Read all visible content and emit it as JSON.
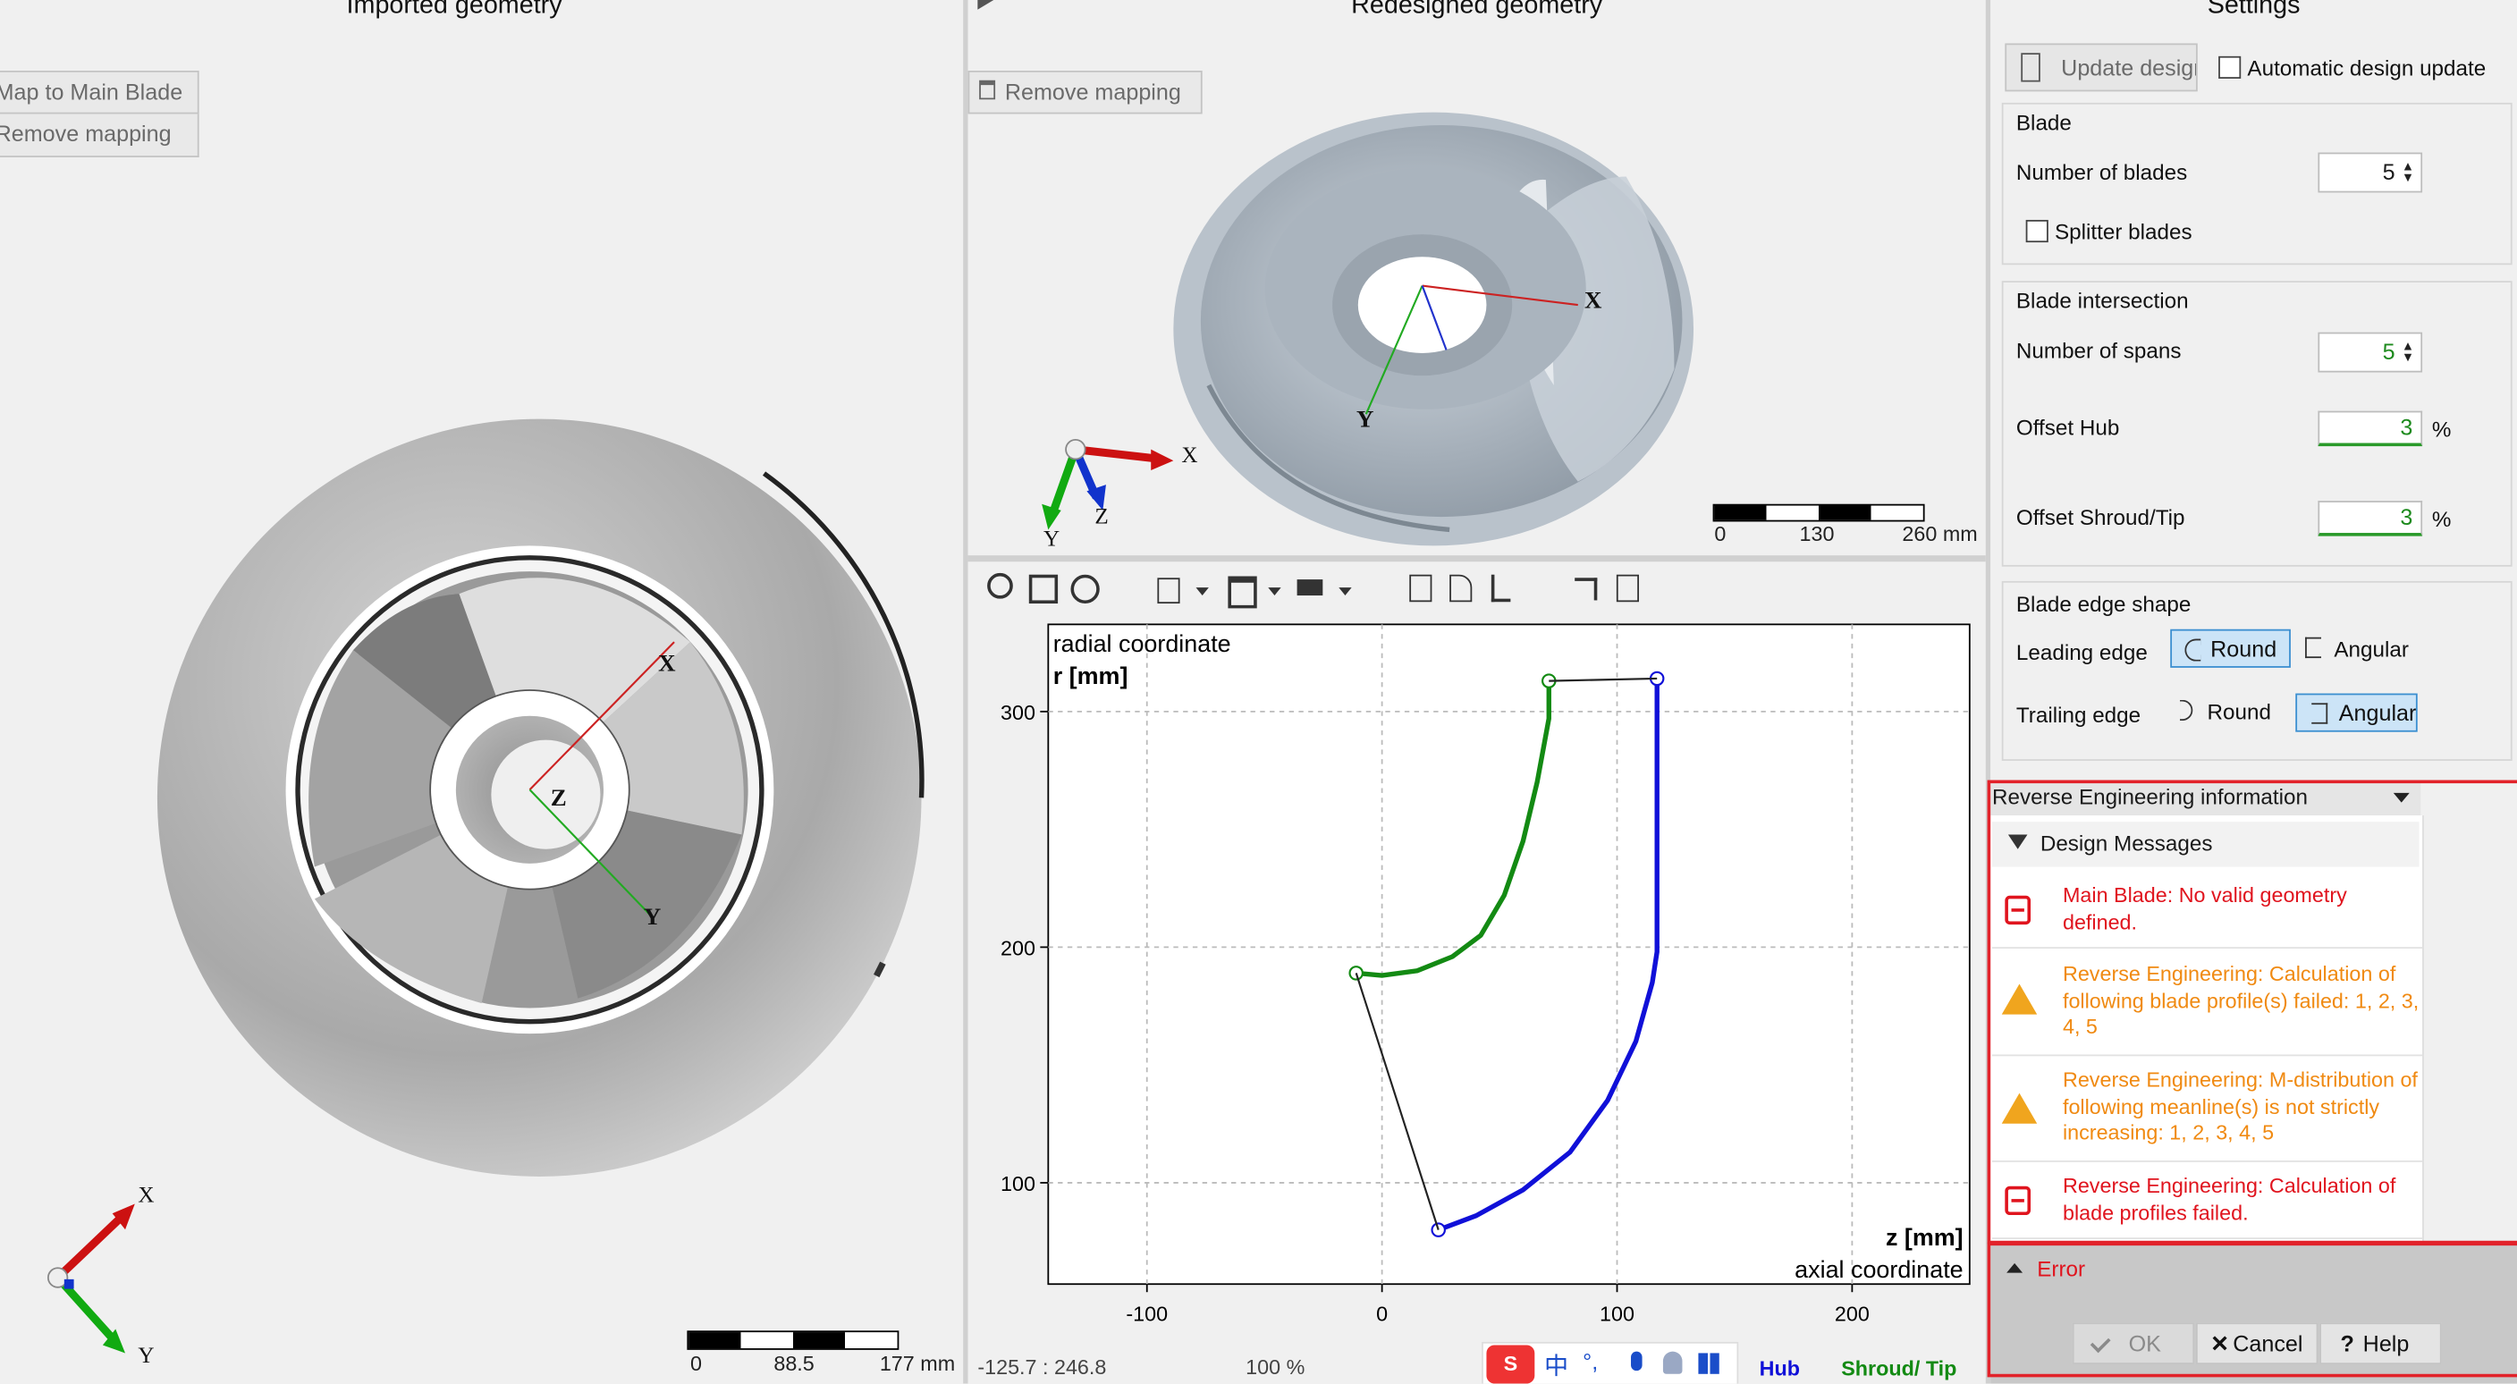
{
  "left_panel": {
    "title": "Imported geometry",
    "map_button": "Map to Main Blade",
    "remove_button": "Remove mapping",
    "axes": {
      "x": "X",
      "y": "Y",
      "z": "Z"
    },
    "scale": {
      "ticks": [
        "0",
        "88.5",
        "177 mm"
      ]
    }
  },
  "top_right_panel": {
    "title": "Redesigned geometry",
    "remove_button": "Remove mapping",
    "axes": {
      "x": "X",
      "y": "Y",
      "z": "Z"
    },
    "scale": {
      "ticks": [
        "0",
        "130",
        "260 mm"
      ]
    }
  },
  "meridional_chart": {
    "status_coords": "-125.7 : 246.8",
    "status_zoom": "100 %",
    "legend": {
      "hub": "Hub",
      "shroud": "Shroud/ Tip"
    },
    "legend_colors": {
      "hub": "#1010d8",
      "shroud": "#138a13"
    },
    "ime_glyphs": {
      "logo": "S",
      "zh": "中",
      "punct": "°,"
    }
  },
  "chart_data": {
    "type": "line",
    "title": "",
    "ylabel_top": "radial coordinate",
    "ylabel_unit": "r [mm]",
    "xlabel_unit": "z [mm]",
    "xlabel_bottom": "axial coordinate",
    "x_ticks": [
      "-100",
      "0",
      "100",
      "200"
    ],
    "y_ticks": [
      "100",
      "200",
      "300"
    ],
    "xlim": [
      -142,
      250
    ],
    "ylim": [
      57,
      337
    ],
    "grid": true,
    "series": [
      {
        "name": "Shroud/ Tip",
        "color": "#138a13",
        "points": [
          [
            -11,
            189
          ],
          [
            0,
            188
          ],
          [
            15,
            190
          ],
          [
            30,
            196
          ],
          [
            42,
            205
          ],
          [
            52,
            222
          ],
          [
            60,
            245
          ],
          [
            66,
            270
          ],
          [
            71,
            297
          ],
          [
            71,
            313
          ]
        ]
      },
      {
        "name": "Hub",
        "color": "#1010d8",
        "points": [
          [
            24,
            80
          ],
          [
            40,
            86
          ],
          [
            60,
            97
          ],
          [
            80,
            113
          ],
          [
            96,
            135
          ],
          [
            108,
            160
          ],
          [
            115,
            185
          ],
          [
            117,
            198
          ],
          [
            117,
            314
          ]
        ]
      },
      {
        "name": "",
        "color": "#222222",
        "points": [
          [
            71,
            313
          ],
          [
            117,
            314
          ]
        ]
      },
      {
        "name": "",
        "color": "#222222",
        "points": [
          [
            -11,
            189
          ],
          [
            24,
            80
          ]
        ]
      }
    ]
  },
  "settings": {
    "title": "Settings",
    "update_button": "Update design",
    "auto_update_label": "Automatic design update",
    "blade_group": "Blade",
    "num_blades_label": "Number of blades",
    "num_blades_value": "5",
    "splitter_label": "Splitter blades",
    "intersection_group": "Blade intersection",
    "num_spans_label": "Number of spans",
    "num_spans_value": "5",
    "offset_hub_label": "Offset Hub",
    "offset_hub_value": "3",
    "offset_shroud_label": "Offset Shroud/Tip",
    "offset_shroud_value": "3",
    "percent": "%",
    "edge_group": "Blade edge shape",
    "leading_edge_label": "Leading edge",
    "trailing_edge_label": "Trailing edge",
    "round_label": "Round",
    "angular_label": "Angular"
  },
  "reverse_panel": {
    "header": "Reverse Engineering information",
    "messages_label": "Design Messages",
    "messages": [
      {
        "type": "error",
        "text": "Main Blade: No valid geometry defined."
      },
      {
        "type": "warning",
        "text": "Reverse Engineering: Calculation of following blade profile(s) failed: 1, 2, 3, 4, 5"
      },
      {
        "type": "warning",
        "text": "Reverse Engineering: M-distribution of following meanline(s) is not strictly increasing: 1, 2, 3, 4, 5"
      },
      {
        "type": "error",
        "text": "Reverse Engineering: Calculation of blade profiles failed."
      }
    ],
    "status": "Error",
    "ok": "OK",
    "cancel": "Cancel",
    "help": "Help"
  }
}
